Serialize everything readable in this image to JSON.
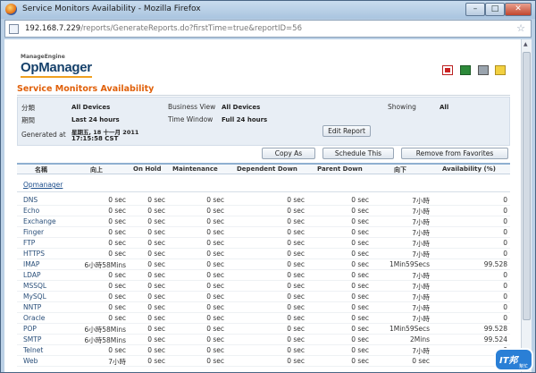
{
  "window": {
    "title": "Service Monitors Availability - Mozilla Firefox",
    "minimize": "–",
    "maximize": "□",
    "close": "✕"
  },
  "urlbar": {
    "host": "192.168.7.229",
    "path": "/reports/GenerateReports.do?firstTime=true&reportID=56"
  },
  "brand": {
    "vendor": "ManageEngine",
    "product": "OpManager"
  },
  "report": {
    "title": "Service Monitors Availability"
  },
  "info": {
    "category_label": "分類",
    "category_value": "All Devices",
    "business_view_label": "Business View",
    "business_view_value": "All Devices",
    "showing_label": "Showing",
    "showing_value": "All",
    "period_label": "期間",
    "period_value": "Last 24 hours",
    "time_window_label": "Time Window",
    "time_window_value": "Full 24 hours",
    "generated_label": "Generated at",
    "generated_value_line1": "星期五, 18 十一月 2011",
    "generated_value_line2": "17:15:58 CST",
    "edit_report": "Edit Report"
  },
  "actions": {
    "copy_as": "Copy As",
    "schedule_this": "Schedule This",
    "remove_favorites": "Remove from Favorites"
  },
  "table": {
    "headers": [
      "名稱",
      "向上",
      "On Hold",
      "Maintenance",
      "Dependent Down",
      "Parent Down",
      "向下",
      "Availability (%)"
    ],
    "group": "Opmanager",
    "rows": [
      {
        "name": "DNS",
        "up": "0 sec",
        "onhold": "0 sec",
        "maint": "0 sec",
        "depdown": "0 sec",
        "parentdown": "0 sec",
        "down": "7小時",
        "avail": "0"
      },
      {
        "name": "Echo",
        "up": "0 sec",
        "onhold": "0 sec",
        "maint": "0 sec",
        "depdown": "0 sec",
        "parentdown": "0 sec",
        "down": "7小時",
        "avail": "0"
      },
      {
        "name": "Exchange",
        "up": "0 sec",
        "onhold": "0 sec",
        "maint": "0 sec",
        "depdown": "0 sec",
        "parentdown": "0 sec",
        "down": "7小時",
        "avail": "0"
      },
      {
        "name": "Finger",
        "up": "0 sec",
        "onhold": "0 sec",
        "maint": "0 sec",
        "depdown": "0 sec",
        "parentdown": "0 sec",
        "down": "7小時",
        "avail": "0"
      },
      {
        "name": "FTP",
        "up": "0 sec",
        "onhold": "0 sec",
        "maint": "0 sec",
        "depdown": "0 sec",
        "parentdown": "0 sec",
        "down": "7小時",
        "avail": "0"
      },
      {
        "name": "HTTPS",
        "up": "0 sec",
        "onhold": "0 sec",
        "maint": "0 sec",
        "depdown": "0 sec",
        "parentdown": "0 sec",
        "down": "7小時",
        "avail": "0"
      },
      {
        "name": "IMAP",
        "up": "6小時58Mins",
        "onhold": "0 sec",
        "maint": "0 sec",
        "depdown": "0 sec",
        "parentdown": "0 sec",
        "down": "1Min59Secs",
        "avail": "99.528"
      },
      {
        "name": "LDAP",
        "up": "0 sec",
        "onhold": "0 sec",
        "maint": "0 sec",
        "depdown": "0 sec",
        "parentdown": "0 sec",
        "down": "7小時",
        "avail": "0"
      },
      {
        "name": "MSSQL",
        "up": "0 sec",
        "onhold": "0 sec",
        "maint": "0 sec",
        "depdown": "0 sec",
        "parentdown": "0 sec",
        "down": "7小時",
        "avail": "0"
      },
      {
        "name": "MySQL",
        "up": "0 sec",
        "onhold": "0 sec",
        "maint": "0 sec",
        "depdown": "0 sec",
        "parentdown": "0 sec",
        "down": "7小時",
        "avail": "0"
      },
      {
        "name": "NNTP",
        "up": "0 sec",
        "onhold": "0 sec",
        "maint": "0 sec",
        "depdown": "0 sec",
        "parentdown": "0 sec",
        "down": "7小時",
        "avail": "0"
      },
      {
        "name": "Oracle",
        "up": "0 sec",
        "onhold": "0 sec",
        "maint": "0 sec",
        "depdown": "0 sec",
        "parentdown": "0 sec",
        "down": "7小時",
        "avail": "0"
      },
      {
        "name": "POP",
        "up": "6小時58Mins",
        "onhold": "0 sec",
        "maint": "0 sec",
        "depdown": "0 sec",
        "parentdown": "0 sec",
        "down": "1Min59Secs",
        "avail": "99.528"
      },
      {
        "name": "SMTP",
        "up": "6小時58Mins",
        "onhold": "0 sec",
        "maint": "0 sec",
        "depdown": "0 sec",
        "parentdown": "0 sec",
        "down": "2Mins",
        "avail": "99.524"
      },
      {
        "name": "Telnet",
        "up": "0 sec",
        "onhold": "0 sec",
        "maint": "0 sec",
        "depdown": "0 sec",
        "parentdown": "0 sec",
        "down": "7小時",
        "avail": "0"
      },
      {
        "name": "Web",
        "up": "7小時",
        "onhold": "0 sec",
        "maint": "0 sec",
        "depdown": "0 sec",
        "parentdown": "0 sec",
        "down": "0 sec",
        "avail": "100"
      }
    ]
  },
  "watermark": {
    "text": "IT邦",
    "sub": "幫忙"
  }
}
